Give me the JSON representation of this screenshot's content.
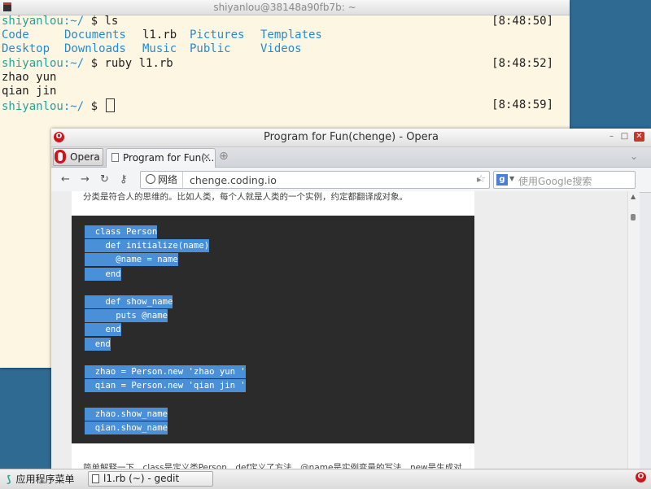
{
  "terminal": {
    "title": "shiyanlou@38148a90fb7b: ~",
    "lines": [
      {
        "user": "shiyanlou",
        "path": ":~/",
        "cmd": " $ ls",
        "time": "[8:48:50]"
      },
      {
        "output": "zhao yun"
      },
      {
        "output": "qian jin"
      }
    ],
    "ls_row1": {
      "a": "Code",
      "b": "Documents",
      "c": "l1.rb",
      "d": "Pictures",
      "e": "Templates"
    },
    "ls_row2": {
      "a": "Desktop",
      "b": "Downloads",
      "c": "Music",
      "d": "Public",
      "e": "Videos"
    },
    "cmd2": {
      "user": "shiyanlou",
      "path": ":~/",
      "cmd": " $ ruby l1.rb",
      "time": "[8:48:52]"
    },
    "cmd3": {
      "user": "shiyanlou",
      "path": ":~/",
      "cmd": " $ ",
      "time": "[8:48:59]"
    }
  },
  "browser": {
    "window_title": "Program for Fun(chenge) - Opera",
    "opera_button": "Opera",
    "tab_title": "Program for Fun(...",
    "address_badge": "网络",
    "address": "chenge.coding.io",
    "search_placeholder": "使用Google搜索",
    "para_top": "分类是符合人的思维的。比如人类，每个人就是人类的一个实例，约定都翻译成对象。",
    "para_bottom": "简单解释一下，class是定义类Person，def定义了方法，@name是实例变量的写法，new是生成对",
    "code_lines": [
      "  class Person",
      "    def initialize(name)",
      "      @name = name",
      "    end",
      "",
      "    def show_name",
      "      puts @name",
      "    end",
      "  end",
      "",
      "  zhao = Person.new 'zhao yun '",
      "  qian = Person.new 'qian jin '",
      "",
      "  zhao.show_name",
      "  qian.show_name"
    ]
  },
  "taskbar": {
    "menu_label": "应用程序菜单",
    "task_label": "l1.rb (~) - gedit"
  },
  "colors": {
    "terminal_bg": "#fdf6e3",
    "prompt_user": "#2aa198",
    "prompt_path": "#268bd2",
    "code_bg": "#2b2b2b",
    "selection": "#4a90d9",
    "desktop": "#2f6a93"
  }
}
